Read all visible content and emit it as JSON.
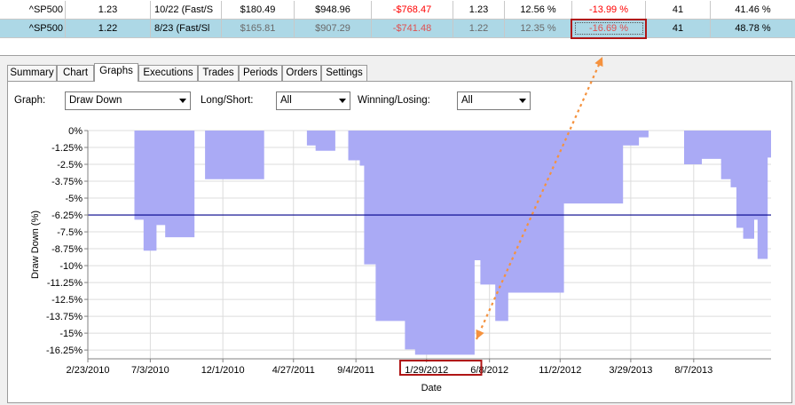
{
  "results_table": {
    "rows": [
      {
        "symbol": "^SP500",
        "c1": "1.23",
        "c2": "10/22 (Fast/S",
        "c3": "$180.49",
        "c4": "$948.96",
        "c5": "-$768.47",
        "c6": "1.23",
        "c7": "12.56 %",
        "c8": "-13.99 %",
        "c9": "41",
        "c10": "41.46 %"
      },
      {
        "symbol": "^SP500",
        "c1": "1.22",
        "c2": "8/23 (Fast/Sl",
        "c3": "$165.81",
        "c4": "$907.29",
        "c5": "-$741.48",
        "c6": "1.22",
        "c7": "12.35 %",
        "c8": "-16.69 %",
        "c9": "41",
        "c10": "48.78 %"
      }
    ]
  },
  "tabs": [
    {
      "label": "Summary"
    },
    {
      "label": "Chart"
    },
    {
      "label": "Graphs",
      "active": true
    },
    {
      "label": "Executions"
    },
    {
      "label": "Trades"
    },
    {
      "label": "Periods"
    },
    {
      "label": "Orders"
    },
    {
      "label": "Settings"
    }
  ],
  "controls": {
    "graph_label": "Graph:",
    "graph_value": "Draw Down",
    "long_short_label": "Long/Short:",
    "long_short_value": "All",
    "winning_losing_label": "Winning/Losing:",
    "winning_losing_value": "All"
  },
  "colors": {
    "area_fill": "#aaaaf5",
    "average_line": "#00008b",
    "annotation_arrow": "#f5923e",
    "highlight_box": "#b01515",
    "selected_row": "#add8e6"
  },
  "chart_data": {
    "type": "area",
    "xlabel": "Date",
    "ylabel": "Draw Down (%)",
    "y_ticks": [
      "0%",
      "-1.25%",
      "-2.5%",
      "-3.75%",
      "-5%",
      "-6.25%",
      "-7.5%",
      "-8.75%",
      "-10%",
      "-11.25%",
      "-12.5%",
      "-13.75%",
      "-15%",
      "-16.25%"
    ],
    "y_tick_values": [
      0,
      -1.25,
      -2.5,
      -3.75,
      -5,
      -6.25,
      -7.5,
      -8.75,
      -10,
      -11.25,
      -12.5,
      -13.75,
      -15,
      -16.25
    ],
    "ylim": [
      -16.9,
      0
    ],
    "x_ticks": [
      "2/23/2010",
      "7/3/2010",
      "12/1/2010",
      "4/27/2011",
      "9/4/2011",
      "1/29/2012",
      "6/8/2012",
      "11/2/2012",
      "3/29/2013",
      "8/7/2013"
    ],
    "x_tick_dates": [
      "2010-02-23",
      "2010-07-03",
      "2010-12-01",
      "2011-04-27",
      "2011-09-04",
      "2012-01-29",
      "2012-06-08",
      "2012-11-02",
      "2013-03-29",
      "2013-08-07"
    ],
    "xlim": [
      "2010-02-23",
      "2014-01-15"
    ],
    "average_line": -6.25,
    "grid": true,
    "series": [
      {
        "points": [
          [
            "2010-02-23",
            0
          ],
          [
            "2010-05-31",
            0
          ],
          [
            "2010-05-31",
            -6.6
          ],
          [
            "2010-06-19",
            -6.6
          ],
          [
            "2010-06-19",
            -8.9
          ],
          [
            "2010-07-16",
            -8.9
          ],
          [
            "2010-07-16",
            -7
          ],
          [
            "2010-08-03",
            -7
          ],
          [
            "2010-08-03",
            -7.9
          ],
          [
            "2010-10-03",
            -7.9
          ],
          [
            "2010-10-03",
            0
          ],
          [
            "2010-10-25",
            0
          ],
          [
            "2010-10-25",
            -3.6
          ],
          [
            "2011-02-25",
            -3.6
          ],
          [
            "2011-02-25",
            0
          ],
          [
            "2011-05-25",
            0
          ],
          [
            "2011-05-25",
            -1.1
          ],
          [
            "2011-06-12",
            -1.1
          ],
          [
            "2011-06-12",
            -1.5
          ],
          [
            "2011-07-23",
            -1.5
          ],
          [
            "2011-07-23",
            0
          ],
          [
            "2011-08-19",
            0
          ],
          [
            "2011-08-19",
            -2.2
          ],
          [
            "2011-09-12",
            -2.2
          ],
          [
            "2011-09-12",
            -2.6
          ],
          [
            "2011-09-21",
            -2.6
          ],
          [
            "2011-09-21",
            -9.9
          ],
          [
            "2011-10-15",
            -9.9
          ],
          [
            "2011-10-15",
            -14.1
          ],
          [
            "2011-12-15",
            -14.1
          ],
          [
            "2011-12-15",
            -16.2
          ],
          [
            "2012-01-05",
            -16.2
          ],
          [
            "2012-01-05",
            -16.6
          ],
          [
            "2012-05-08",
            -16.6
          ],
          [
            "2012-05-08",
            -9.6
          ],
          [
            "2012-05-20",
            -9.6
          ],
          [
            "2012-05-20",
            -11.4
          ],
          [
            "2012-06-20",
            -11.4
          ],
          [
            "2012-06-20",
            -14.1
          ],
          [
            "2012-07-17",
            -14.1
          ],
          [
            "2012-07-17",
            -12
          ],
          [
            "2012-11-10",
            -12
          ],
          [
            "2012-11-10",
            -5.4
          ],
          [
            "2013-03-13",
            -5.4
          ],
          [
            "2013-03-13",
            -1.1
          ],
          [
            "2013-04-15",
            -1.1
          ],
          [
            "2013-04-15",
            -0.5
          ],
          [
            "2013-05-05",
            -0.5
          ],
          [
            "2013-05-05",
            0
          ],
          [
            "2013-07-18",
            0
          ],
          [
            "2013-07-18",
            -2.5
          ],
          [
            "2013-08-24",
            -2.5
          ],
          [
            "2013-08-24",
            -2.1
          ],
          [
            "2013-10-03",
            -2.1
          ],
          [
            "2013-10-03",
            -3.6
          ],
          [
            "2013-10-23",
            -3.6
          ],
          [
            "2013-10-23",
            -4.2
          ],
          [
            "2013-11-04",
            -4.2
          ],
          [
            "2013-11-04",
            -7.2
          ],
          [
            "2013-11-18",
            -7.2
          ],
          [
            "2013-11-18",
            -8
          ],
          [
            "2013-12-11",
            -8
          ],
          [
            "2013-12-11",
            -6.6
          ],
          [
            "2013-12-18",
            -6.6
          ],
          [
            "2013-12-18",
            -9.5
          ],
          [
            "2014-01-08",
            -9.5
          ],
          [
            "2014-01-08",
            -2
          ],
          [
            "2014-01-15",
            -2
          ],
          [
            "2014-01-15",
            0
          ]
        ]
      }
    ]
  }
}
